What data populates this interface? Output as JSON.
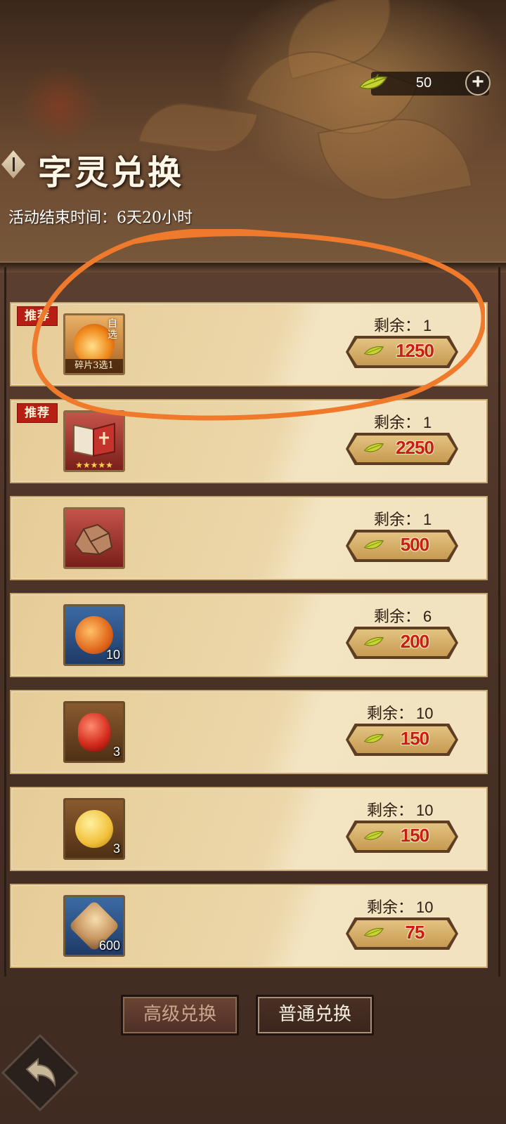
{
  "header": {
    "title": "字灵兑换",
    "event_end": "活动结束时间：6天20小时"
  },
  "currency": {
    "amount": "50",
    "plus_icon": "plus-icon",
    "leaf_color": "#c6d431"
  },
  "items": [
    {
      "recommended": "推荐",
      "icon": "fire-orb-icon",
      "qty": "",
      "sub": "碎片3选1",
      "self": "自选",
      "remaining_label": "剩余：",
      "remaining": "1",
      "price": "1250"
    },
    {
      "recommended": "推荐",
      "icon": "book-icon",
      "qty": "",
      "stars": "★★★★★",
      "remaining_label": "剩余：",
      "remaining": "1",
      "price": "2250"
    },
    {
      "icon": "ore-icon",
      "qty": "",
      "remaining_label": "剩余：",
      "remaining": "1",
      "price": "500"
    },
    {
      "icon": "dragon-orb-icon",
      "qty": "10",
      "remaining_label": "剩余：",
      "remaining": "6",
      "price": "200"
    },
    {
      "icon": "red-gem-icon",
      "qty": "3",
      "remaining_label": "剩余：",
      "remaining": "10",
      "price": "150"
    },
    {
      "icon": "gold-coin-icon",
      "qty": "3",
      "remaining_label": "剩余：",
      "remaining": "10",
      "price": "150"
    },
    {
      "icon": "jade-token-icon",
      "qty": "600",
      "remaining_label": "剩余：",
      "remaining": "10",
      "price": "75"
    }
  ],
  "buttons": {
    "advanced": "高级兑换",
    "normal": "普通兑换"
  },
  "colors": {
    "price_text": "#c91e12",
    "recommend_tag": "#b81f14",
    "annotation_circle": "#f07a2c"
  }
}
